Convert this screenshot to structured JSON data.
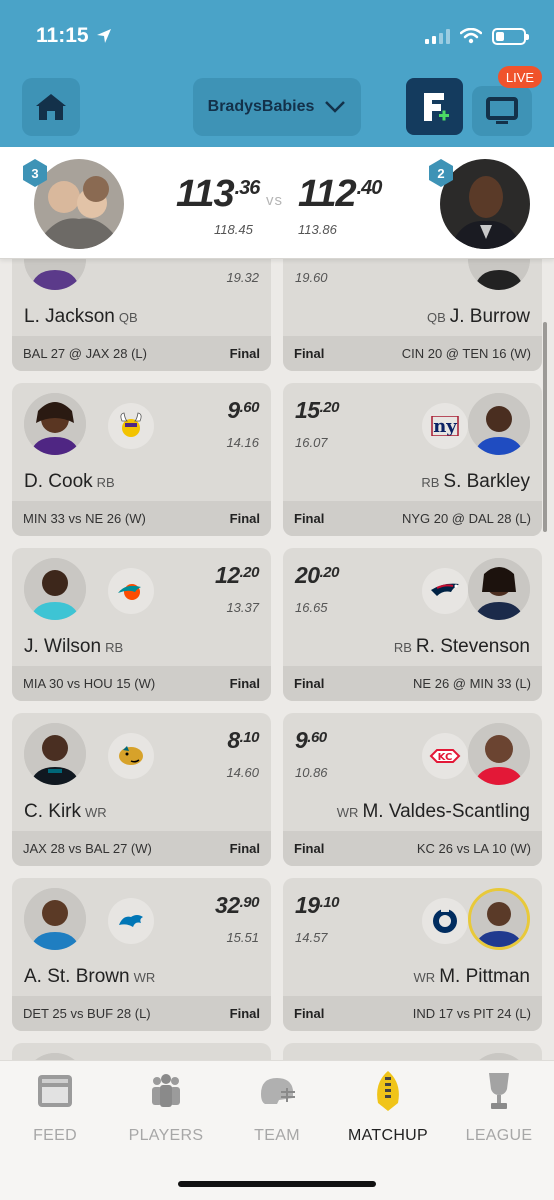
{
  "status": {
    "time": "11:15"
  },
  "nav": {
    "team_name": "BradysBabies",
    "live_label": "LIVE"
  },
  "matchup": {
    "left": {
      "rank": "3",
      "score_int": "113",
      "score_dec": ".36",
      "projected": "118.45"
    },
    "vs_label": "vs",
    "right": {
      "rank": "2",
      "score_int": "112",
      "score_dec": ".40",
      "projected": "113.86"
    }
  },
  "rows": [
    {
      "left": {
        "name": "L. Jackson",
        "pos": "QB",
        "pts_int": "",
        "pts_dec": "",
        "proj": "19.32",
        "game": "BAL 27 @ JAX 28 (L)",
        "status": "Final",
        "team_logo": "ravens-logo"
      },
      "right": {
        "name": "J. Burrow",
        "pos": "QB",
        "pts_int": "",
        "pts_dec": "",
        "proj": "19.60",
        "game": "CIN 20 @ TEN 16 (W)",
        "status": "Final",
        "team_logo": "bengals-logo"
      }
    },
    {
      "left": {
        "name": "D. Cook",
        "pos": "RB",
        "pts_int": "9",
        "pts_dec": ".60",
        "proj": "14.16",
        "game": "MIN 33 vs NE 26 (W)",
        "status": "Final",
        "team_logo": "vikings-logo"
      },
      "right": {
        "name": "S. Barkley",
        "pos": "RB",
        "pts_int": "15",
        "pts_dec": ".20",
        "proj": "16.07",
        "game": "NYG 20 @ DAL 28 (L)",
        "status": "Final",
        "team_logo": "giants-logo"
      }
    },
    {
      "left": {
        "name": "J. Wilson",
        "pos": "RB",
        "pts_int": "12",
        "pts_dec": ".20",
        "proj": "13.37",
        "game": "MIA 30 vs HOU 15 (W)",
        "status": "Final",
        "team_logo": "dolphins-logo"
      },
      "right": {
        "name": "R. Stevenson",
        "pos": "RB",
        "pts_int": "20",
        "pts_dec": ".20",
        "proj": "16.65",
        "game": "NE 26 @ MIN 33 (L)",
        "status": "Final",
        "team_logo": "patriots-logo"
      }
    },
    {
      "left": {
        "name": "C. Kirk",
        "pos": "WR",
        "pts_int": "8",
        "pts_dec": ".10",
        "proj": "14.60",
        "game": "JAX 28 vs BAL 27 (W)",
        "status": "Final",
        "team_logo": "jaguars-logo"
      },
      "right": {
        "name": "M. Valdes-Scantling",
        "pos": "WR",
        "pts_int": "9",
        "pts_dec": ".60",
        "proj": "10.86",
        "game": "KC 26 vs LA 10 (W)",
        "status": "Final",
        "team_logo": "chiefs-logo"
      }
    },
    {
      "left": {
        "name": "A. St. Brown",
        "pos": "WR",
        "pts_int": "32",
        "pts_dec": ".90",
        "proj": "15.51",
        "game": "DET 25 vs BUF 28 (L)",
        "status": "Final",
        "team_logo": "lions-logo"
      },
      "right": {
        "name": "M. Pittman",
        "pos": "WR",
        "pts_int": "19",
        "pts_dec": ".10",
        "proj": "14.57",
        "game": "IND 17 vs PIT 24 (L)",
        "status": "Final",
        "team_logo": "colts-logo"
      }
    }
  ],
  "tabs": [
    {
      "label": "FEED",
      "icon": "feed-icon",
      "active": false
    },
    {
      "label": "PLAYERS",
      "icon": "players-icon",
      "active": false
    },
    {
      "label": "TEAM",
      "icon": "helmet-icon",
      "active": false
    },
    {
      "label": "MATCHUP",
      "icon": "football-icon",
      "active": true
    },
    {
      "label": "LEAGUE",
      "icon": "trophy-icon",
      "active": false
    }
  ],
  "colors": {
    "header": "#4aa3c8",
    "nav_dark": "#143b5e",
    "live": "#f0532c",
    "rank_badge": "#3e93b6"
  }
}
